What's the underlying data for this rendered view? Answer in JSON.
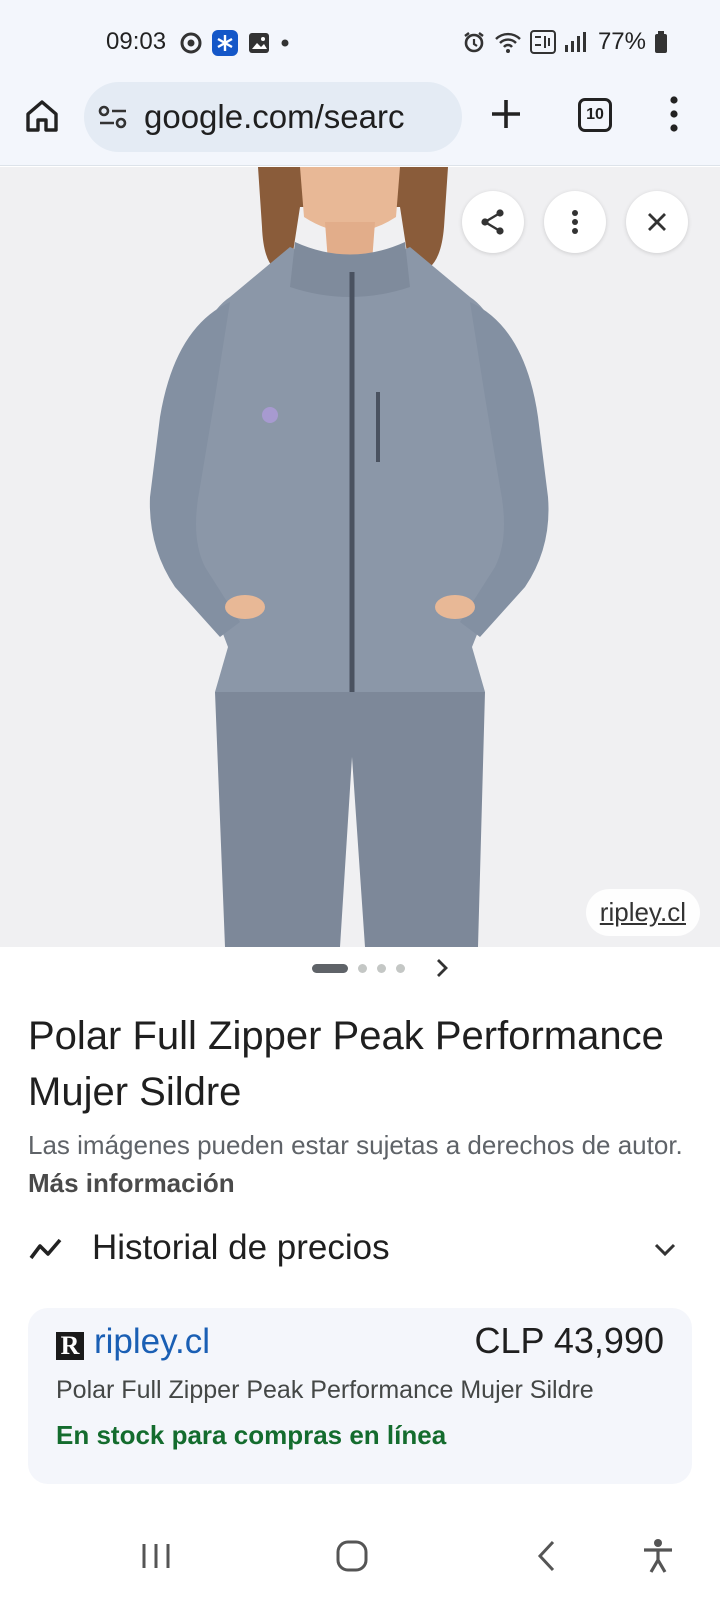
{
  "status_bar": {
    "time": "09:03",
    "battery": "77%"
  },
  "browser": {
    "url_display": "google.com/searc",
    "tab_count": "10"
  },
  "image_viewer": {
    "source_domain": "ripley.cl",
    "page_count": 4,
    "current_page": 1
  },
  "product": {
    "title": "Polar Full Zipper Peak Performance Mujer Sildre",
    "disclaimer_text": "Las imágenes pueden estar sujetas a derechos de autor.",
    "more_info_label": "Más información"
  },
  "price_history": {
    "label": "Historial de precios"
  },
  "offer": {
    "store_logo_letter": "R",
    "store_name": "ripley.cl",
    "price": "CLP 43,990",
    "title": "Polar Full Zipper Peak Performance Mujer Sildre",
    "stock": "En stock para compras en línea"
  },
  "colors": {
    "link_blue": "#1a5fb4",
    "stock_green": "#146c2e",
    "jacket_gray": "#8b97a8"
  }
}
